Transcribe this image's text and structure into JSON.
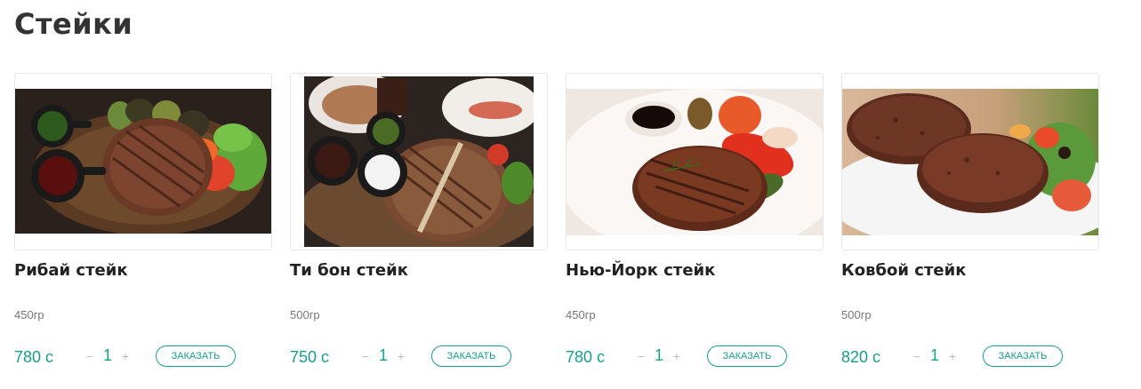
{
  "section": {
    "title": "Стейки"
  },
  "products": [
    {
      "name": "Рибай стейк",
      "weight": "450гр",
      "price": "780 с",
      "quantity": "1",
      "minus": "−",
      "plus": "+",
      "order_label": "ЗАКАЗАТЬ"
    },
    {
      "name": "Ти бон стейк",
      "weight": "500гр",
      "price": "750 с",
      "quantity": "1",
      "minus": "−",
      "plus": "+",
      "order_label": "ЗАКАЗАТЬ"
    },
    {
      "name": "Нью-Йорк стейк",
      "weight": "450гр",
      "price": "780 с",
      "quantity": "1",
      "minus": "−",
      "plus": "+",
      "order_label": "ЗАКАЗАТЬ"
    },
    {
      "name": "Ковбой стейк",
      "weight": "500гр",
      "price": "820 с",
      "quantity": "1",
      "minus": "−",
      "plus": "+",
      "order_label": "ЗАКАЗАТЬ"
    }
  ],
  "colors": {
    "accent": "#16a08a",
    "title": "#333333",
    "muted": "#777777",
    "border": "#e6e6e6"
  }
}
